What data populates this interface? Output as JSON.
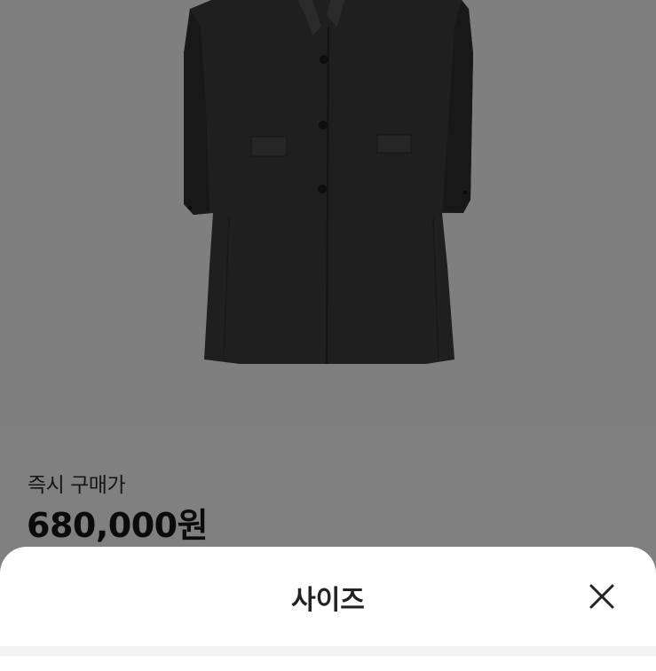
{
  "product": {
    "image_icon": "coat-image",
    "price_label": "즉시 구매가",
    "price_value": "680,000원"
  },
  "size_sheet": {
    "title": "사이즈",
    "close_icon": "close-icon"
  },
  "colors": {
    "overlay": "#808080",
    "sheet": "#ffffff",
    "coat": "#1f1f1f"
  }
}
